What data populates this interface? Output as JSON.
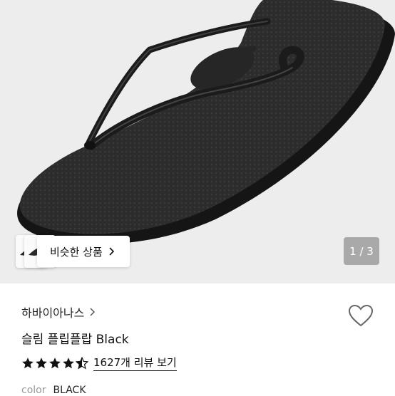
{
  "gallery": {
    "similar_label": "비슷한 상품",
    "counter": "1 / 3",
    "current_image": 1,
    "total_images": 3
  },
  "product": {
    "brand": "하바이아나스",
    "name": "슬림 플립플랍 Black",
    "rating": 4.5,
    "review_link": "1627개 리뷰 보기",
    "option_label": "color",
    "option_value": "BLACK"
  },
  "icons": {
    "brand_chevron": "chevron-right-icon",
    "similar_chevron": "chevron-right-icon",
    "wishlist": "heart-outline-icon",
    "rating": "star-icon"
  },
  "colors": {
    "gallery_bg": "#ededed",
    "counter_bg": "#a9a9a9",
    "sandal": "#2b2b2b"
  }
}
